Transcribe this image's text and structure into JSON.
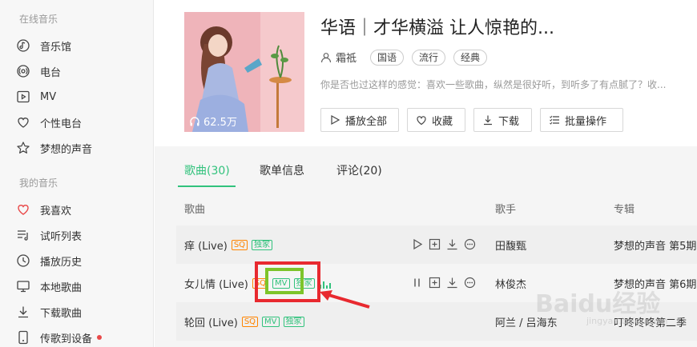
{
  "sidebar": {
    "online_section": "在线音乐",
    "online_items": [
      {
        "label": "音乐馆",
        "icon": "music-hall-icon"
      },
      {
        "label": "电台",
        "icon": "radio-icon"
      },
      {
        "label": "MV",
        "icon": "mv-icon"
      },
      {
        "label": "个性电台",
        "icon": "heart-radio-icon"
      },
      {
        "label": "梦想的声音",
        "icon": "star-icon"
      }
    ],
    "my_section": "我的音乐",
    "my_items": [
      {
        "label": "我喜欢",
        "icon": "heart-icon"
      },
      {
        "label": "试听列表",
        "icon": "playlist-icon"
      },
      {
        "label": "播放历史",
        "icon": "clock-icon"
      },
      {
        "label": "本地歌曲",
        "icon": "monitor-icon"
      },
      {
        "label": "下载歌曲",
        "icon": "download-icon"
      },
      {
        "label": "传歌到设备",
        "icon": "device-icon"
      }
    ]
  },
  "playlist": {
    "title": "华语｜才华横溢 让人惊艳的...",
    "play_count": "62.5万",
    "creator": "霜祗",
    "tags": [
      "国语",
      "流行",
      "经典"
    ],
    "description": "你是否也过这样的感觉：喜欢一些歌曲，纵然是很好听，到听多了有点腻了？收...",
    "buttons": {
      "play_all": "播放全部",
      "favorite": "收藏",
      "download": "下载",
      "batch": "批量操作"
    }
  },
  "tabs": [
    {
      "label": "歌曲(30)",
      "active": true
    },
    {
      "label": "歌单信息",
      "active": false
    },
    {
      "label": "评论(20)",
      "active": false
    }
  ],
  "list_headers": {
    "song": "歌曲",
    "singer": "歌手",
    "album": "专辑"
  },
  "songs": [
    {
      "title": "痒 (Live)",
      "sq": "SQ",
      "mv": "",
      "exclusive": "独家",
      "singer": "田馥甄",
      "album": "梦想的声音 第5期"
    },
    {
      "title": "女儿情 (Live)",
      "sq": "SQ",
      "mv": "MV",
      "exclusive": "独家",
      "singer": "林俊杰",
      "album": "梦想的声音 第6期"
    },
    {
      "title": "轮回 (Live)",
      "sq": "SQ",
      "mv": "MV",
      "exclusive": "独家",
      "singer": "阿兰 / 吕海东",
      "album": "叮咚咚咚第二季"
    }
  ],
  "watermark": {
    "main": "Baidu经验",
    "sub": "jingyan.baidu.com"
  },
  "colors": {
    "accent": "#31c27c",
    "sq": "#ff8400",
    "annotation_red": "#e8292f",
    "annotation_green": "#7dc42a"
  }
}
